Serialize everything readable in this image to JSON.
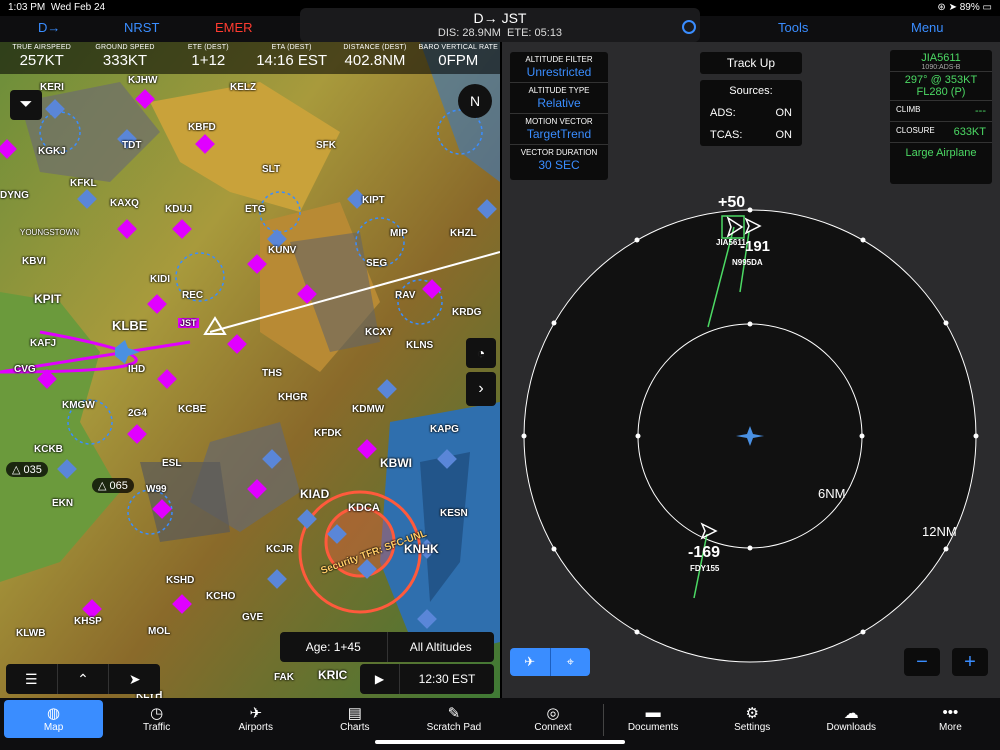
{
  "status": {
    "time": "1:03 PM",
    "date": "Wed Feb 24",
    "battery": "89%"
  },
  "topnav": {
    "direct_to": "D→",
    "nrst": "NRST",
    "emer": "EMER",
    "dest": "JST",
    "dest_prefix": "D→",
    "dis": "DIS: 28.9NM",
    "ete": "ETE: 05:13",
    "tools": "Tools",
    "menu": "Menu"
  },
  "databar": [
    {
      "label": "TRUE AIRSPEED",
      "value": "257KT"
    },
    {
      "label": "GROUND SPEED",
      "value": "333KT"
    },
    {
      "label": "ETE (DEST)",
      "value": "1+12"
    },
    {
      "label": "ETA (DEST)",
      "value": "14:16 EST"
    },
    {
      "label": "DISTANCE (DEST)",
      "value": "402.8NM"
    },
    {
      "label": "BARO VERTICAL RATE",
      "value": "0FPM"
    }
  ],
  "map": {
    "airports": [
      "KERI",
      "KJHW",
      "KELZ",
      "KBFD",
      "TDT",
      "KGKJ",
      "SFK",
      "KFKL",
      "KAXQ",
      "KDUJ",
      "ETG",
      "SLT",
      "KIPT",
      "KUNV",
      "MIP",
      "KHZL",
      "KBVI",
      "YOUNGSTOWN",
      "KIDI",
      "SEG",
      "REC",
      "RAV",
      "KPIT",
      "KLBE",
      "JST",
      "KAFJ",
      "KCXY",
      "KRDG",
      "IHD",
      "THS",
      "KLNS",
      "KHGR",
      "KDMW",
      "KMGW",
      "2G4",
      "KCBE",
      "KFDK",
      "KAPG",
      "KCKB",
      "KBWI",
      "ESL",
      "KIAD",
      "KDCA",
      "W99",
      "EKN",
      "KESN",
      "KCJR",
      "KSHD",
      "KNHK",
      "KCHO",
      "GVE",
      "KHSP",
      "MOL",
      "KLWB",
      "FAK",
      "KRIC",
      "KLYH",
      "CVG",
      "DYNG"
    ],
    "alt_tags": [
      "035",
      "065"
    ],
    "tfr_label": "Security TFR: SFC-UNL",
    "age_label": "Age: 1+45",
    "altitudes_label": "All Altitudes",
    "time_label": "12:30 EST",
    "play": "▶"
  },
  "traffic": {
    "filters": [
      {
        "label": "ALTITUDE FILTER",
        "value": "Unrestricted"
      },
      {
        "label": "ALTITUDE TYPE",
        "value": "Relative"
      },
      {
        "label": "MOTION VECTOR",
        "value": "TargetTrend"
      },
      {
        "label": "VECTOR DURATION",
        "value": "30 SEC"
      }
    ],
    "track_up": "Track Up",
    "sources_title": "Sources:",
    "sources": [
      {
        "name": "ADS:",
        "state": "ON"
      },
      {
        "name": "TCAS:",
        "state": "ON"
      }
    ],
    "target": {
      "id": "JIA5611",
      "source": "1090:ADS-B",
      "track": "297° @ 353KT",
      "alt": "FL280 (P)",
      "climb_label": "CLIMB",
      "climb_value": "---",
      "closure_label": "CLOSURE",
      "closure_value": "633KT",
      "type": "Large Airplane"
    },
    "ring_inner": "6NM",
    "ring_outer": "12NM",
    "targets": [
      {
        "alt": "+50",
        "callsign": "JIA5611"
      },
      {
        "alt": "-191",
        "callsign": "N995DA"
      },
      {
        "alt": "-169",
        "callsign": "FDY155"
      }
    ],
    "zoom_out": "−",
    "zoom_in": "+"
  },
  "tabs": [
    {
      "label": "Map",
      "icon": "◍"
    },
    {
      "label": "Traffic",
      "icon": "◷"
    },
    {
      "label": "Airports",
      "icon": "✈"
    },
    {
      "label": "Charts",
      "icon": "▤"
    },
    {
      "label": "Scratch Pad",
      "icon": "✎"
    },
    {
      "label": "Connext",
      "icon": "◎"
    },
    {
      "label": "Documents",
      "icon": "▬"
    },
    {
      "label": "Settings",
      "icon": "⚙"
    },
    {
      "label": "Downloads",
      "icon": "☁"
    },
    {
      "label": "More",
      "icon": "•••"
    }
  ],
  "colors": {
    "accent": "#3a8dff",
    "emergency": "#ff3b30",
    "traffic_green": "#4cd964",
    "tfr": "#ff5a3c",
    "route": "#e000ff"
  }
}
